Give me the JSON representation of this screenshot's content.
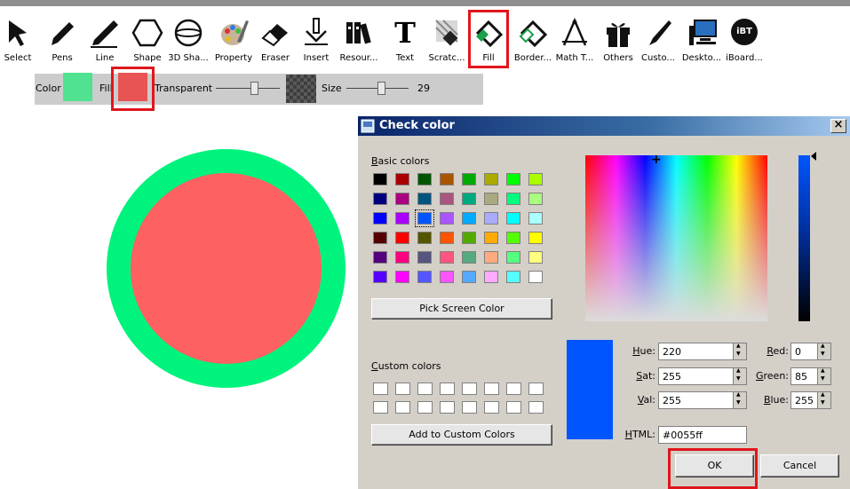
{
  "toolbar": {
    "tools": [
      {
        "id": "select",
        "label": "Select"
      },
      {
        "id": "pens",
        "label": "Pens"
      },
      {
        "id": "line",
        "label": "Line"
      },
      {
        "id": "shape",
        "label": "Shape"
      },
      {
        "id": "shape3d",
        "label": "3D Sha..."
      },
      {
        "id": "property",
        "label": "Property"
      },
      {
        "id": "eraser",
        "label": "Eraser"
      },
      {
        "id": "insert",
        "label": "Insert"
      },
      {
        "id": "resources",
        "label": "Resour..."
      },
      {
        "id": "text",
        "label": "Text"
      },
      {
        "id": "scratch",
        "label": "Scratc..."
      },
      {
        "id": "fill",
        "label": "Fill"
      },
      {
        "id": "border",
        "label": "Border..."
      },
      {
        "id": "math",
        "label": "Math T..."
      },
      {
        "id": "others",
        "label": "Others"
      },
      {
        "id": "custom",
        "label": "Custo..."
      },
      {
        "id": "desktop",
        "label": "Deskto..."
      },
      {
        "id": "iboard",
        "label": "iBoard..."
      }
    ],
    "text_glyph": "T",
    "iboard_glyph": "iBT"
  },
  "propbar": {
    "color_label": "Color",
    "fill_label": "Fill",
    "transparent_label": "Transparent",
    "transparent_level": 0.62,
    "size_label": "Size",
    "size_value": "29",
    "size_level": 0.58,
    "color_swatch": "#50e290",
    "fill_swatch": "#e85353"
  },
  "canvas": {
    "circle_border_color": "#00f37c",
    "circle_fill_color": "#fe6161"
  },
  "dialog": {
    "title": "Check color",
    "close_glyph": "×",
    "basic_colors_label": "Basic colors",
    "basic_colors": [
      [
        "#000000",
        "#aa0000",
        "#005500",
        "#aa5500",
        "#00aa00",
        "#aaaa00",
        "#00ff00",
        "#aaff00"
      ],
      [
        "#00007f",
        "#aa007f",
        "#00557f",
        "#aa557f",
        "#00aa7f",
        "#aaaa7f",
        "#00ff7f",
        "#aaff7f"
      ],
      [
        "#0000ff",
        "#aa00ff",
        "#0055ff",
        "#aa55ff",
        "#00aaff",
        "#aaaaff",
        "#00ffff",
        "#aaffff"
      ],
      [
        "#550000",
        "#ff0000",
        "#555500",
        "#ff5500",
        "#55aa00",
        "#ffaa00",
        "#55ff00",
        "#ffff00"
      ],
      [
        "#55007f",
        "#ff007f",
        "#55557f",
        "#ff557f",
        "#55aa7f",
        "#ffaa7f",
        "#55ff7f",
        "#ffff7f"
      ],
      [
        "#5500ff",
        "#ff00ff",
        "#5555ff",
        "#ff55ff",
        "#55aaff",
        "#ffaaff",
        "#55ffff",
        "#ffffff"
      ]
    ],
    "selected_basic": [
      2,
      2
    ],
    "pick_screen_label": "Pick Screen Color",
    "custom_colors_label": "Custom colors",
    "add_custom_label": "Add to Custom Colors",
    "preview_color": "#0055ff",
    "hue_label": "Hue:",
    "hue": "220",
    "sat_label": "Sat:",
    "sat": "255",
    "val_label": "Val:",
    "val": "255",
    "red_label": "Red:",
    "red": "0",
    "green_label": "Green:",
    "green": "85",
    "blue_label": "Blue:",
    "blue": "255",
    "html_label": "HTML:",
    "html": "#0055ff",
    "ok_label": "OK",
    "cancel_label": "Cancel"
  }
}
